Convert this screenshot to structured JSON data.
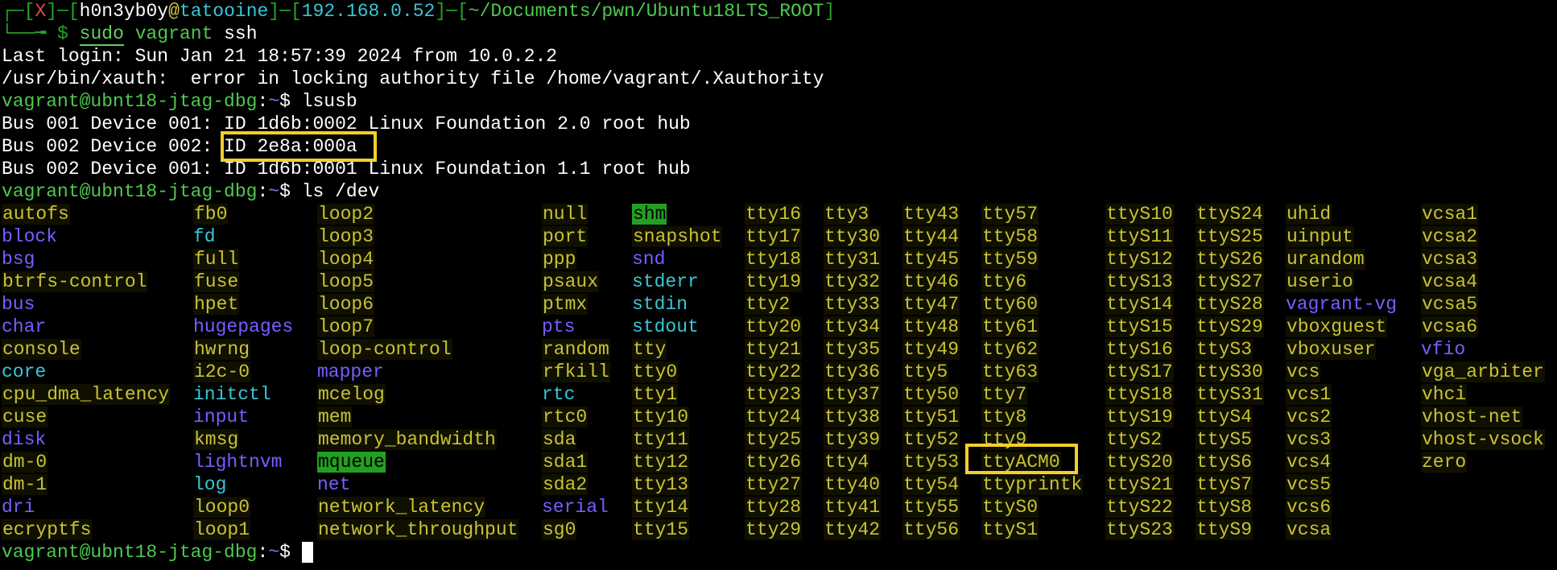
{
  "prompt_header": {
    "open": "┌─[",
    "status": "X",
    "sep1": "]─[",
    "user": "h0n3yb0y",
    "at": "@",
    "host": "tatooine",
    "sep2": "]─[",
    "ip": "192.168.0.52",
    "sep3": "]─[",
    "path": "~/Documents/pwn/Ubuntu18LTS_ROOT",
    "close": "]"
  },
  "prompt_line2": {
    "prefix": "└──╼ $ ",
    "cmd1": "sudo",
    "cmd2": " vagrant",
    "cmd3": " ssh"
  },
  "lines": {
    "last_login": "Last login: Sun Jan 21 18:57:39 2024 from 10.0.2.2",
    "xauth": "/usr/bin/xauth:  error in locking authority file /home/vagrant/.Xauthority",
    "lsusb_1": "Bus 001 Device 001: ID 1d6b:0002 Linux Foundation 2.0 root hub",
    "lsusb_2_prefix": "Bus 002 Device 002: ",
    "lsusb_2_id": "ID 2e8a:000a",
    "lsusb_3": "Bus 002 Device 001: ID 1d6b:0001 Linux Foundation 1.1 root hub"
  },
  "vagrant_prompt": {
    "user_host": "vagrant@ubnt18-jtag-dbg",
    "colon": ":",
    "tilde": "~",
    "dollar": "$ "
  },
  "commands": {
    "lsusb": "lsusb",
    "lsdev": "ls /dev"
  },
  "colors": {
    "prompt_green": "#4ec94e",
    "highlight_box": "#f2cf2b",
    "device_yellow": "#c9c236",
    "dir_blue": "#7b5cff",
    "link_cyan": "#39c6d6"
  },
  "dev_columns": [
    [
      [
        "autofs",
        "file"
      ],
      [
        "block",
        "dir"
      ],
      [
        "bsg",
        "dir"
      ],
      [
        "btrfs-control",
        "file"
      ],
      [
        "bus",
        "dir"
      ],
      [
        "char",
        "dir"
      ],
      [
        "console",
        "file"
      ],
      [
        "core",
        "link"
      ],
      [
        "cpu_dma_latency",
        "file"
      ],
      [
        "cuse",
        "file"
      ],
      [
        "disk",
        "dir"
      ],
      [
        "dm-0",
        "file"
      ],
      [
        "dm-1",
        "file"
      ],
      [
        "dri",
        "dir"
      ],
      [
        "ecryptfs",
        "file"
      ]
    ],
    [
      [
        "fb0",
        "file"
      ],
      [
        "fd",
        "link"
      ],
      [
        "full",
        "file"
      ],
      [
        "fuse",
        "file"
      ],
      [
        "hpet",
        "file"
      ],
      [
        "hugepages",
        "dir"
      ],
      [
        "hwrng",
        "file"
      ],
      [
        "i2c-0",
        "file"
      ],
      [
        "initctl",
        "link"
      ],
      [
        "input",
        "dir"
      ],
      [
        "kmsg",
        "file"
      ],
      [
        "lightnvm",
        "dir"
      ],
      [
        "log",
        "link"
      ],
      [
        "loop0",
        "file"
      ],
      [
        "loop1",
        "file"
      ]
    ],
    [
      [
        "loop2",
        "file"
      ],
      [
        "loop3",
        "file"
      ],
      [
        "loop4",
        "file"
      ],
      [
        "loop5",
        "file"
      ],
      [
        "loop6",
        "file"
      ],
      [
        "loop7",
        "file"
      ],
      [
        "loop-control",
        "file"
      ],
      [
        "mapper",
        "dir"
      ],
      [
        "mcelog",
        "file"
      ],
      [
        "mem",
        "file"
      ],
      [
        "memory_bandwidth",
        "file"
      ],
      [
        "mqueue",
        "sticky"
      ],
      [
        "net",
        "dir"
      ],
      [
        "network_latency",
        "file"
      ],
      [
        "network_throughput",
        "file"
      ]
    ],
    [
      [
        "null",
        "file"
      ],
      [
        "port",
        "file"
      ],
      [
        "ppp",
        "file"
      ],
      [
        "psaux",
        "file"
      ],
      [
        "ptmx",
        "file"
      ],
      [
        "pts",
        "dir"
      ],
      [
        "random",
        "file"
      ],
      [
        "rfkill",
        "file"
      ],
      [
        "rtc",
        "link"
      ],
      [
        "rtc0",
        "file"
      ],
      [
        "sda",
        "file"
      ],
      [
        "sda1",
        "file"
      ],
      [
        "sda2",
        "file"
      ],
      [
        "serial",
        "dir"
      ],
      [
        "sg0",
        "file"
      ]
    ],
    [
      [
        "shm",
        "sticky"
      ],
      [
        "snapshot",
        "file"
      ],
      [
        "snd",
        "dir"
      ],
      [
        "stderr",
        "link"
      ],
      [
        "stdin",
        "link"
      ],
      [
        "stdout",
        "link"
      ],
      [
        "tty",
        "file"
      ],
      [
        "tty0",
        "file"
      ],
      [
        "tty1",
        "file"
      ],
      [
        "tty10",
        "file"
      ],
      [
        "tty11",
        "file"
      ],
      [
        "tty12",
        "file"
      ],
      [
        "tty13",
        "file"
      ],
      [
        "tty14",
        "file"
      ],
      [
        "tty15",
        "file"
      ]
    ],
    [
      [
        "tty16",
        "file"
      ],
      [
        "tty17",
        "file"
      ],
      [
        "tty18",
        "file"
      ],
      [
        "tty19",
        "file"
      ],
      [
        "tty2",
        "file"
      ],
      [
        "tty20",
        "file"
      ],
      [
        "tty21",
        "file"
      ],
      [
        "tty22",
        "file"
      ],
      [
        "tty23",
        "file"
      ],
      [
        "tty24",
        "file"
      ],
      [
        "tty25",
        "file"
      ],
      [
        "tty26",
        "file"
      ],
      [
        "tty27",
        "file"
      ],
      [
        "tty28",
        "file"
      ],
      [
        "tty29",
        "file"
      ]
    ],
    [
      [
        "tty3",
        "file"
      ],
      [
        "tty30",
        "file"
      ],
      [
        "tty31",
        "file"
      ],
      [
        "tty32",
        "file"
      ],
      [
        "tty33",
        "file"
      ],
      [
        "tty34",
        "file"
      ],
      [
        "tty35",
        "file"
      ],
      [
        "tty36",
        "file"
      ],
      [
        "tty37",
        "file"
      ],
      [
        "tty38",
        "file"
      ],
      [
        "tty39",
        "file"
      ],
      [
        "tty4",
        "file"
      ],
      [
        "tty40",
        "file"
      ],
      [
        "tty41",
        "file"
      ],
      [
        "tty42",
        "file"
      ]
    ],
    [
      [
        "tty43",
        "file"
      ],
      [
        "tty44",
        "file"
      ],
      [
        "tty45",
        "file"
      ],
      [
        "tty46",
        "file"
      ],
      [
        "tty47",
        "file"
      ],
      [
        "tty48",
        "file"
      ],
      [
        "tty49",
        "file"
      ],
      [
        "tty5",
        "file"
      ],
      [
        "tty50",
        "file"
      ],
      [
        "tty51",
        "file"
      ],
      [
        "tty52",
        "file"
      ],
      [
        "tty53",
        "file"
      ],
      [
        "tty54",
        "file"
      ],
      [
        "tty55",
        "file"
      ],
      [
        "tty56",
        "file"
      ]
    ],
    [
      [
        "tty57",
        "file"
      ],
      [
        "tty58",
        "file"
      ],
      [
        "tty59",
        "file"
      ],
      [
        "tty6",
        "file"
      ],
      [
        "tty60",
        "file"
      ],
      [
        "tty61",
        "file"
      ],
      [
        "tty62",
        "file"
      ],
      [
        "tty63",
        "file"
      ],
      [
        "tty7",
        "file"
      ],
      [
        "tty8",
        "file"
      ],
      [
        "tty9",
        "file"
      ],
      [
        "ttyACM0",
        "file"
      ],
      [
        "ttyprintk",
        "file"
      ],
      [
        "ttyS0",
        "file"
      ],
      [
        "ttyS1",
        "file"
      ]
    ],
    [
      [
        "ttyS10",
        "file"
      ],
      [
        "ttyS11",
        "file"
      ],
      [
        "ttyS12",
        "file"
      ],
      [
        "ttyS13",
        "file"
      ],
      [
        "ttyS14",
        "file"
      ],
      [
        "ttyS15",
        "file"
      ],
      [
        "ttyS16",
        "file"
      ],
      [
        "ttyS17",
        "file"
      ],
      [
        "ttyS18",
        "file"
      ],
      [
        "ttyS19",
        "file"
      ],
      [
        "ttyS2",
        "file"
      ],
      [
        "ttyS20",
        "file"
      ],
      [
        "ttyS21",
        "file"
      ],
      [
        "ttyS22",
        "file"
      ],
      [
        "ttyS23",
        "file"
      ]
    ],
    [
      [
        "ttyS24",
        "file"
      ],
      [
        "ttyS25",
        "file"
      ],
      [
        "ttyS26",
        "file"
      ],
      [
        "ttyS27",
        "file"
      ],
      [
        "ttyS28",
        "file"
      ],
      [
        "ttyS29",
        "file"
      ],
      [
        "ttyS3",
        "file"
      ],
      [
        "ttyS30",
        "file"
      ],
      [
        "ttyS31",
        "file"
      ],
      [
        "ttyS4",
        "file"
      ],
      [
        "ttyS5",
        "file"
      ],
      [
        "ttyS6",
        "file"
      ],
      [
        "ttyS7",
        "file"
      ],
      [
        "ttyS8",
        "file"
      ],
      [
        "ttyS9",
        "file"
      ]
    ],
    [
      [
        "uhid",
        "file"
      ],
      [
        "uinput",
        "file"
      ],
      [
        "urandom",
        "file"
      ],
      [
        "userio",
        "file"
      ],
      [
        "vagrant-vg",
        "dir"
      ],
      [
        "vboxguest",
        "file"
      ],
      [
        "vboxuser",
        "file"
      ],
      [
        "vcs",
        "file"
      ],
      [
        "vcs1",
        "file"
      ],
      [
        "vcs2",
        "file"
      ],
      [
        "vcs3",
        "file"
      ],
      [
        "vcs4",
        "file"
      ],
      [
        "vcs5",
        "file"
      ],
      [
        "vcs6",
        "file"
      ],
      [
        "vcsa",
        "file"
      ]
    ],
    [
      [
        "vcsa1",
        "file"
      ],
      [
        "vcsa2",
        "file"
      ],
      [
        "vcsa3",
        "file"
      ],
      [
        "vcsa4",
        "file"
      ],
      [
        "vcsa5",
        "file"
      ],
      [
        "vcsa6",
        "file"
      ],
      [
        "vfio",
        "dir"
      ],
      [
        "vga_arbiter",
        "file"
      ],
      [
        "vhci",
        "file"
      ],
      [
        "vhost-net",
        "file"
      ],
      [
        "vhost-vsock",
        "file"
      ],
      [
        "zero",
        "file"
      ]
    ]
  ]
}
